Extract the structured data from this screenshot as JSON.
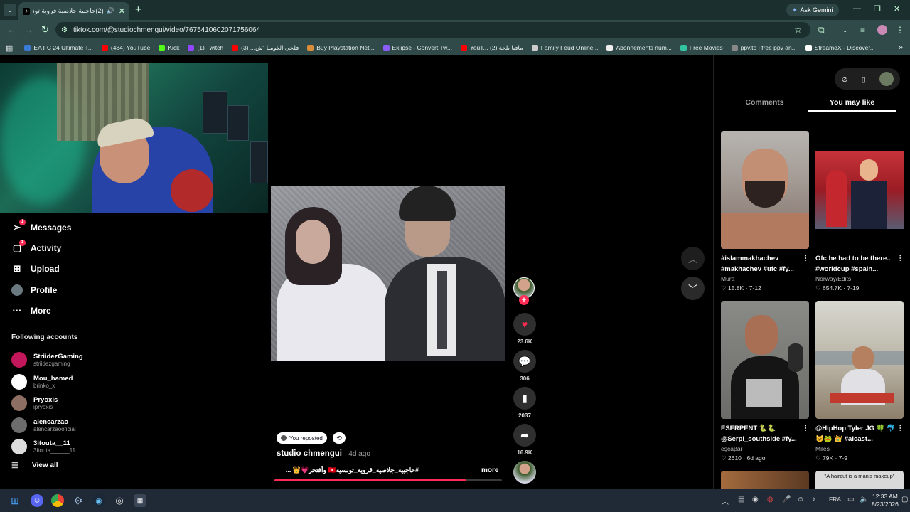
{
  "browser": {
    "tab_title": "(2)حاجبية جلاصية قروية تونسية",
    "url": "tiktok.com/@studiochmengui/video/7675410602071756064",
    "ask_gemini": "Ask Gemini",
    "bookmarks": [
      {
        "label": "EA FC 24 Ultimate T...",
        "color": "#3a7bd5"
      },
      {
        "label": "(484) YouTube",
        "color": "#ff0000"
      },
      {
        "label": "Kick",
        "color": "#53fc18"
      },
      {
        "label": "(1) Twitch",
        "color": "#9146ff"
      },
      {
        "label": "فلجي الكومبا \"ش... (3)",
        "color": "#ff0000"
      },
      {
        "label": "Buy Playstation Net...",
        "color": "#d98c3a"
      },
      {
        "label": "Eklipse - Convert Tw...",
        "color": "#8b5cf6"
      },
      {
        "label": "YouT... مافيا بلحة (2)",
        "color": "#ff0000"
      },
      {
        "label": "Family Feud Online...",
        "color": "#cccccc"
      },
      {
        "label": "Abonnements num...",
        "color": "#eeeeee"
      },
      {
        "label": "Free Movies",
        "color": "#33c4a0"
      },
      {
        "label": "ppv.to | free ppv an...",
        "color": "#888888"
      },
      {
        "label": "StreameX - Discover...",
        "color": "#ffffff"
      }
    ]
  },
  "sidebar": {
    "nav": [
      {
        "label": "Messages",
        "icon": "messages-icon",
        "badge": "1"
      },
      {
        "label": "Activity",
        "icon": "activity-icon",
        "badge": "1"
      },
      {
        "label": "Upload",
        "icon": "upload-icon",
        "badge": ""
      },
      {
        "label": "Profile",
        "icon": "profile-avatar",
        "badge": ""
      },
      {
        "label": "More",
        "icon": "more-icon",
        "badge": ""
      }
    ],
    "following_title": "Following accounts",
    "following": [
      {
        "name": "StriidezGaming",
        "username": "striidezgaming",
        "color": "#c2185b"
      },
      {
        "name": "Mou_hamed",
        "username": "brinko_x",
        "color": "#ffffff"
      },
      {
        "name": "Pryoxis",
        "username": "ipryoxis",
        "color": "#8d6e63"
      },
      {
        "name": "alencarzao",
        "username": "alencarzaooficial",
        "color": "#6d6d6d"
      },
      {
        "name": "3itouta__11",
        "username": "3itouta______11",
        "color": "#dddddd"
      }
    ],
    "view_all": "View all"
  },
  "video": {
    "reposted_label": "You reposted",
    "author": "studio chmengui",
    "age": "· 4d ago",
    "caption": "#حاجبية_جلاصية_قروية_تونسية🇹🇳 وأفتخر💗👑 ...",
    "more": "more",
    "progress": 0.84,
    "likes": "23.6K",
    "comments": "306",
    "saves": "2037",
    "shares": "16.9K"
  },
  "right_panel": {
    "tabs": [
      "Comments",
      "You may like"
    ],
    "active_tab": "You may like",
    "cards": [
      {
        "title": "#islammakhachev #makhachev #ufc #fy...",
        "user": "Mura",
        "likes": "15.8K",
        "date": "7-12"
      },
      {
        "title": "Ofc he had to be there.. #worldcup #spain...",
        "user": "Norway/Edits",
        "likes": "654.7K",
        "date": "7-19"
      },
      {
        "title": "ESERPENT 🐍🐍 @Serpi_southside #fy...",
        "user": "eşçaβâř",
        "likes": "2610",
        "date": "6d ago"
      },
      {
        "title": "@HipHop Tyler JG 🍀 🐬😺🐸 👑 #aicast...",
        "user": "Miles",
        "likes": "79K",
        "date": "7-9"
      }
    ],
    "peek_caption": "\"A haircut is a man's makeup\""
  },
  "taskbar": {
    "lang": "FRA",
    "time": "12:33 AM",
    "date": "8/23/2026"
  }
}
